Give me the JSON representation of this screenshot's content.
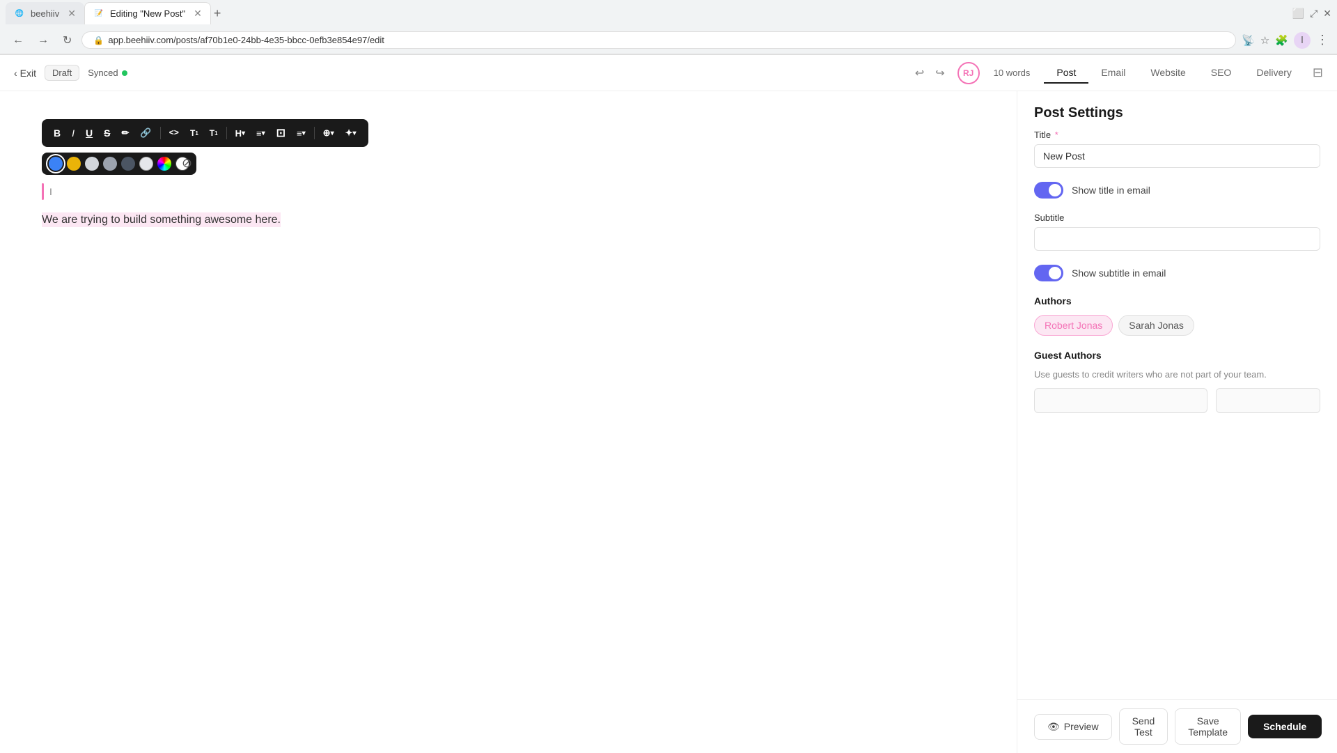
{
  "browser": {
    "tabs": [
      {
        "id": "beehiiv",
        "label": "beehiiv",
        "active": false,
        "favicon": "🌐"
      },
      {
        "id": "editing",
        "label": "Editing \"New Post\"",
        "active": true,
        "favicon": "📝"
      }
    ],
    "url": "app.beehiiv.com/posts/af70b1e0-24bb-4e35-bbcc-0efb3e854e97/edit",
    "new_tab_symbol": "+"
  },
  "app_toolbar": {
    "exit_label": "Exit",
    "draft_label": "Draft",
    "synced_label": "Synced",
    "word_count": "10 words",
    "user_initials": "RJ"
  },
  "nav_tabs": [
    {
      "id": "post",
      "label": "Post",
      "active": true
    },
    {
      "id": "email",
      "label": "Email",
      "active": false
    },
    {
      "id": "website",
      "label": "Website",
      "active": false
    },
    {
      "id": "seo",
      "label": "SEO",
      "active": false
    },
    {
      "id": "delivery",
      "label": "Delivery",
      "active": false
    }
  ],
  "editor": {
    "body_text": "We are trying to build something awesome here.",
    "cursor_visible": true
  },
  "format_toolbar": {
    "buttons": [
      {
        "id": "bold",
        "symbol": "B",
        "label": "bold"
      },
      {
        "id": "italic",
        "symbol": "I",
        "label": "italic"
      },
      {
        "id": "underline",
        "symbol": "U",
        "label": "underline"
      },
      {
        "id": "strikethrough",
        "symbol": "S̶",
        "label": "strikethrough"
      },
      {
        "id": "highlight",
        "symbol": "✏",
        "label": "highlight"
      },
      {
        "id": "link",
        "symbol": "🔗",
        "label": "link"
      },
      {
        "id": "code",
        "symbol": "<>",
        "label": "code"
      },
      {
        "id": "superscript",
        "symbol": "T↑",
        "label": "superscript"
      },
      {
        "id": "subscript",
        "symbol": "T↓",
        "label": "subscript"
      },
      {
        "id": "heading",
        "symbol": "H▾",
        "label": "heading"
      },
      {
        "id": "list",
        "symbol": "≡▾",
        "label": "list"
      },
      {
        "id": "block",
        "symbol": "⊡",
        "label": "block"
      },
      {
        "id": "align",
        "symbol": "≡▾",
        "label": "align"
      },
      {
        "id": "embed",
        "symbol": "⊕▾",
        "label": "embed"
      },
      {
        "id": "ai",
        "symbol": "✦▾",
        "label": "ai"
      }
    ]
  },
  "color_palette": {
    "colors": [
      {
        "id": "blue",
        "value": "#3b82f6",
        "selected": true
      },
      {
        "id": "yellow",
        "value": "#eab308",
        "selected": false
      },
      {
        "id": "light-gray",
        "value": "#d1d5db",
        "selected": false
      },
      {
        "id": "mid-gray",
        "value": "#9ca3af",
        "selected": false
      },
      {
        "id": "dark-gray",
        "value": "#6b7280",
        "selected": false
      },
      {
        "id": "white",
        "value": "#f9fafb",
        "selected": false
      },
      {
        "id": "rainbow",
        "value": "rainbow",
        "selected": false
      },
      {
        "id": "none",
        "value": "none",
        "selected": false
      }
    ]
  },
  "sidebar": {
    "title": "Post Settings",
    "title_field": {
      "label": "Title",
      "required": true,
      "value": "New Post",
      "placeholder": ""
    },
    "show_title_toggle": {
      "label": "Show title in email",
      "enabled": true
    },
    "subtitle_field": {
      "label": "Subtitle",
      "value": "",
      "placeholder": ""
    },
    "show_subtitle_toggle": {
      "label": "Show subtitle in email",
      "enabled": true
    },
    "authors_section": {
      "label": "Authors",
      "authors": [
        {
          "id": "robert",
          "name": "Robert Jonas",
          "active": true
        },
        {
          "id": "sarah",
          "name": "Sarah Jonas",
          "active": false
        }
      ]
    },
    "guest_authors_section": {
      "label": "Guest Authors",
      "description": "Use guests to credit writers who are not part of your team."
    }
  },
  "bottom_bar": {
    "preview_label": "Preview",
    "send_test_label": "Send Test",
    "save_template_label": "Save Template",
    "schedule_label": "Schedule"
  }
}
